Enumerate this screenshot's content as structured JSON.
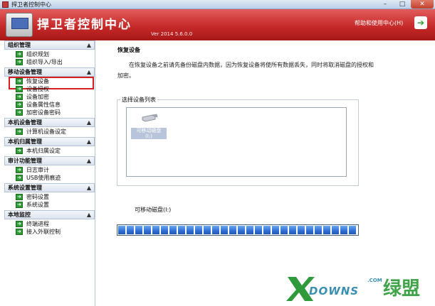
{
  "window": {
    "title": "捍卫者控制中心",
    "min": "–",
    "max": "□",
    "close": "✕"
  },
  "banner": {
    "app_title": "捍卫者控制中心",
    "version": "Ver 2014 5.6.0.0",
    "help": "帮助和使用中心(H)",
    "help_icon": "arrow-right-icon",
    "help_glyph": "➔"
  },
  "sidebar": {
    "collapse_glyph": "▲",
    "arrow_glyph": "➜",
    "groups": [
      {
        "title": "组织管理",
        "items": [
          "组织规划",
          "组织导入/导出"
        ]
      },
      {
        "title": "移动设备管理",
        "items": [
          "恢复设备",
          "设备授权",
          "设备加密",
          "设备属性信息",
          "加密设备密码"
        ]
      },
      {
        "title": "本机设备管理",
        "items": [
          "计算机设备设定"
        ]
      },
      {
        "title": "本机归属管理",
        "items": [
          "本机归属设定"
        ]
      },
      {
        "title": "审计功能管理",
        "items": [
          "日志审计",
          "USB使用痕迹"
        ]
      },
      {
        "title": "系统设置管理",
        "items": [
          "密码设置",
          "系统设置"
        ]
      },
      {
        "title": "本地监控",
        "items": [
          "终端进程",
          "接入外联控制"
        ]
      }
    ],
    "selected": "恢复设备"
  },
  "main": {
    "section_title": "恢复设备",
    "notice": "在恢复设备之前请先备份磁盘内数据，因为恢复设备将使所有数据丢失，同时将取消磁盘的授权和加密。",
    "device_list_legend": "选择设备列表",
    "devices": [
      {
        "name": "可移动磁盘",
        "drive": "(I:)"
      }
    ],
    "status": "可移动磁盘(I:)",
    "progress": 1.0
  },
  "watermark": {
    "text": "DOWNS",
    "com": ".COM",
    "cn": "绿盟"
  },
  "colors": {
    "banner_red": "#c72a2a",
    "nav_arrow_green": "#2e9d35",
    "selection_red": "#d42020",
    "progress_blue": "#2f6fd4"
  }
}
